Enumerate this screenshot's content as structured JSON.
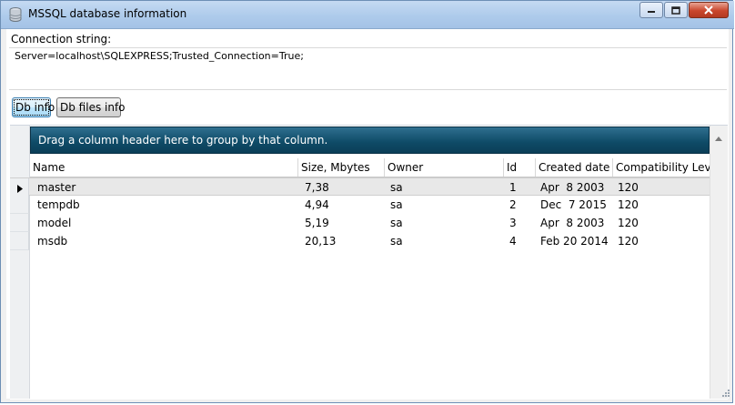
{
  "window": {
    "title": "MSSQL database information"
  },
  "connection": {
    "label": "Connection string:",
    "value": "Server=localhost\\SQLEXPRESS;Trusted_Connection=True;"
  },
  "toolbar": {
    "db_info_label": "Db info",
    "db_files_info_label": "Db files info"
  },
  "grid": {
    "group_panel_text": "Drag a column header here to group by that column.",
    "columns": [
      "Name",
      "Size, Mbytes",
      "Owner",
      "Id",
      "Created date",
      "Compatibility Level"
    ],
    "rows": [
      [
        "master",
        "7,38",
        "sa",
        "1",
        "Apr  8 2003",
        "120"
      ],
      [
        "tempdb",
        "4,94",
        "sa",
        "2",
        "Dec  7 2015",
        "120"
      ],
      [
        "model",
        "5,19",
        "sa",
        "3",
        "Apr  8 2003",
        "120"
      ],
      [
        "msdb",
        "20,13",
        "sa",
        "4",
        "Feb 20 2014",
        "120"
      ]
    ],
    "selected_row": 0
  },
  "icons": {
    "app": "database-icon",
    "minimize": "minimize-icon",
    "maximize": "maximize-icon",
    "close": "close-icon",
    "row_indicator": "current-row-arrow-icon",
    "scroll_up": "scroll-up-arrow-icon"
  },
  "colors": {
    "group_panel": "#0e4a66",
    "titlebar": "#aecbeb",
    "close_button": "#c9462c"
  }
}
